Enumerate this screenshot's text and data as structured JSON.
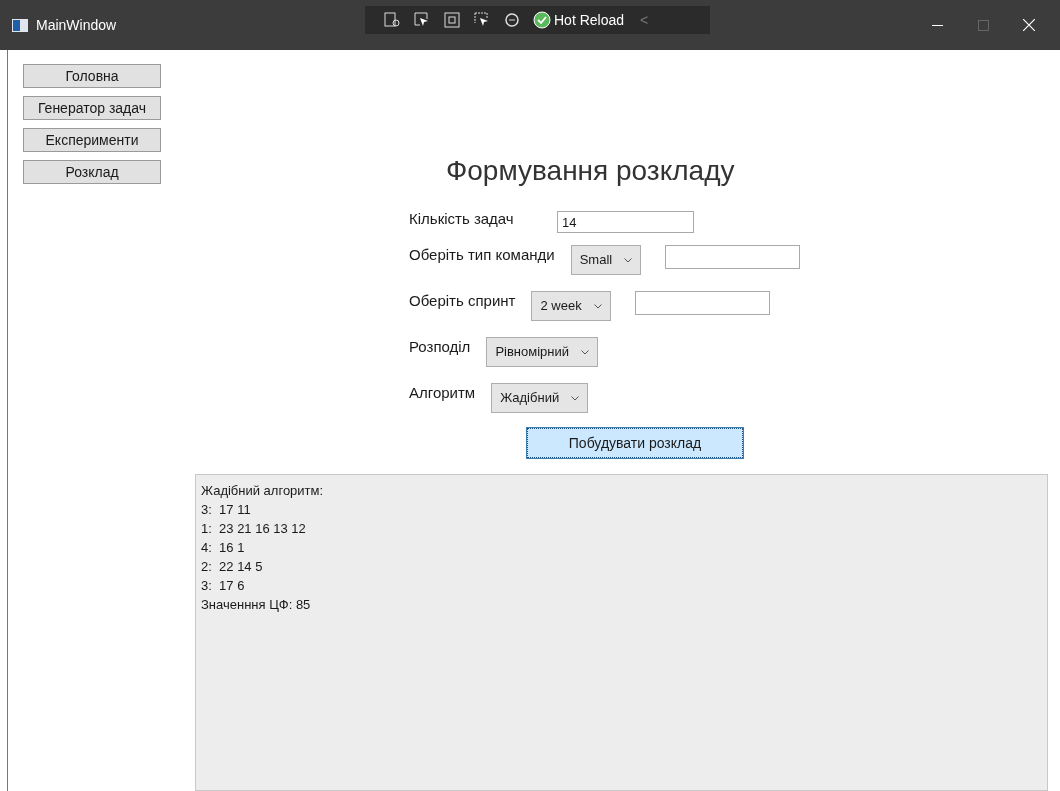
{
  "window": {
    "title": "MainWindow"
  },
  "toolbar": {
    "hot_reload": "Hot Reload",
    "collapse": "<"
  },
  "nav": [
    {
      "label": "Головна"
    },
    {
      "label": "Генератор задач"
    },
    {
      "label": "Експерименти"
    },
    {
      "label": "Розклад"
    }
  ],
  "heading": "Формування розкладу",
  "form": [
    {
      "kind": "text",
      "label": "Кількість задач",
      "value": "14"
    },
    {
      "kind": "select",
      "label": "Оберіть тип команди",
      "value": "Small",
      "extra_field": true
    },
    {
      "kind": "select",
      "label": "Оберіть спринт",
      "value": "2 week",
      "extra_field": true
    },
    {
      "kind": "select",
      "label": "Розподіл",
      "value": "Рівномірний",
      "extra_field": false
    },
    {
      "kind": "select",
      "label": "Алгоритм",
      "value": "Жадібний",
      "extra_field": false
    }
  ],
  "build_button": {
    "label": "Побудувати розклад",
    "focused": true
  },
  "output": [
    "Жадібний алгоритм:",
    "3:  17 11",
    "1:  23 21 16 13 12",
    "4:  16 1",
    "2:  22 14 5",
    "3:  17 6",
    "Значенння ЦФ: 85"
  ]
}
